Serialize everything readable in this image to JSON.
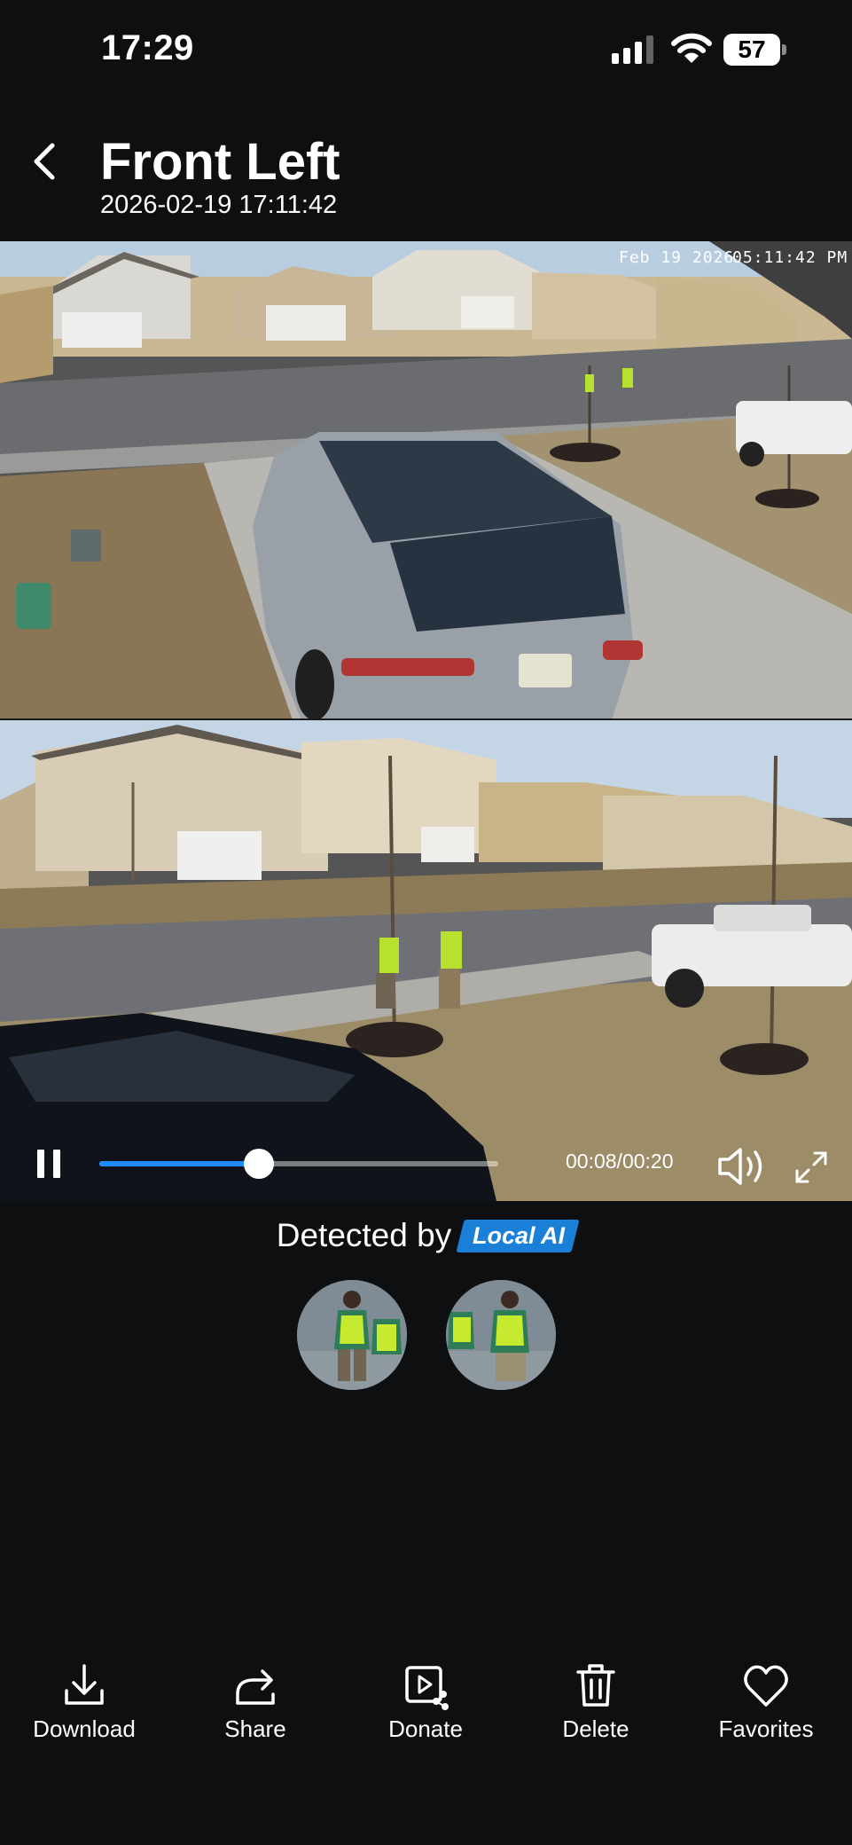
{
  "status_bar": {
    "time": "17:29",
    "battery": "57"
  },
  "header": {
    "title": "Front Left",
    "timestamp": "2026-02-19 17:11:42"
  },
  "camera_overlay": {
    "date": "Feb 19 2026",
    "clock": "05:11:42 PM"
  },
  "player": {
    "time_readout": "00:08/00:20",
    "progress": 0.4,
    "state": "playing"
  },
  "detection": {
    "label": "Detected by",
    "badge": "Local AI"
  },
  "actions": [
    {
      "label": "Download",
      "icon": "download-icon"
    },
    {
      "label": "Share",
      "icon": "share-icon"
    },
    {
      "label": "Donate",
      "icon": "donate-icon"
    },
    {
      "label": "Delete",
      "icon": "trash-icon"
    },
    {
      "label": "Favorites",
      "icon": "heart-icon"
    }
  ],
  "colors": {
    "background": "#0e0f11",
    "accent": "#1f8bff",
    "badge": "#1a7fd6"
  }
}
